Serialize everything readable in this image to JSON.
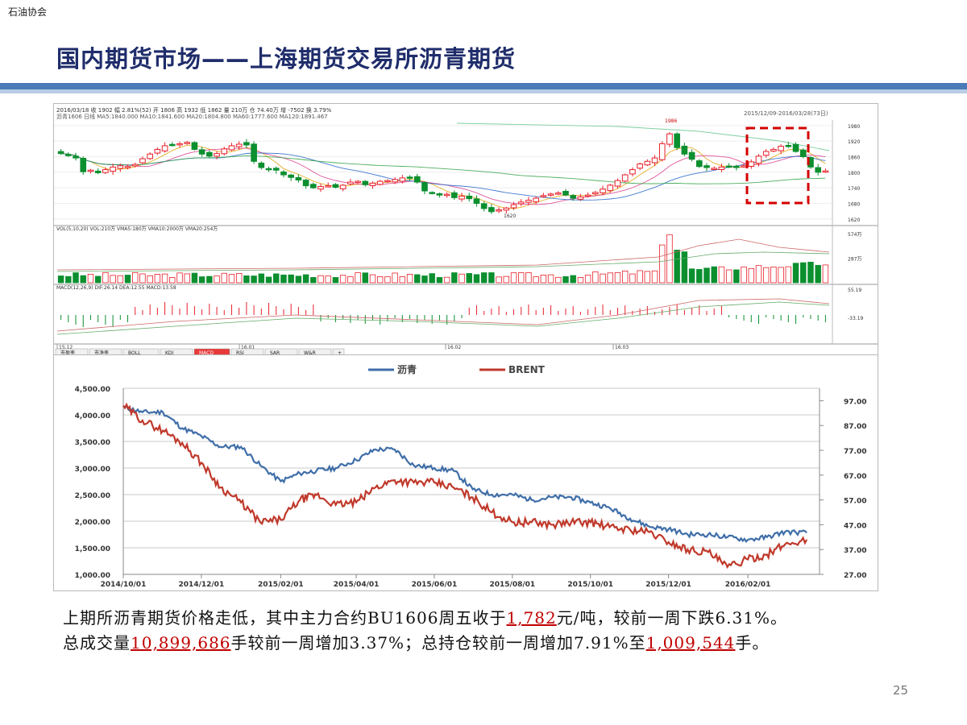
{
  "header": {
    "org": "石油协会",
    "title": "国内期货市场——上海期货交易所沥青期货"
  },
  "kline": {
    "info_row1": "2016/03/18  收 1902  幅 2.81%(52)  开 1806  高 1932  低 1862  量 210万  仓 74.40万  增 -7502  换 3.79%",
    "info_row2": "沥青1606  日线  MA5:1840.000  MA10:1841.600  MA20:1804.800  MA60:1777.600  MA120:1891.467",
    "range_label": "2015/12/09-2016/03/28(73日)",
    "price_ticks": [
      "1980",
      "1920",
      "1860",
      "1800",
      "1740",
      "1680",
      "1620"
    ],
    "high_label": "1986",
    "low_label": "1620",
    "vol_info": "VOL(5,10,20)  VOL:210万  VMA5:180万  VMA10:2000万  VMA20:254万",
    "vol_ticks": [
      "574万",
      "287万"
    ],
    "macd_info": "MACD(12,26,9)  DIF:26.14  DEA:12.55  MACD:13.58",
    "macd_ticks": [
      "55.19",
      "-33.19"
    ],
    "date_labels": [
      "15.12",
      "16.01",
      "16.02",
      "16.03"
    ],
    "tabs": [
      "市盈率",
      "市净率",
      "BOLL",
      "KDJ",
      "MACD",
      "RSI",
      "SAR",
      "W&R",
      "+"
    ],
    "colors": {
      "up": "#e8202a",
      "down": "#0b8f2f",
      "box": "#d40000"
    }
  },
  "chart_data": {
    "type": "line",
    "series": [
      {
        "name": "沥青",
        "axis": "left",
        "color": "#3f6ea8",
        "x": [
          "2014/10/01",
          "2014/10/16",
          "2014/11/01",
          "2014/11/16",
          "2014/12/01",
          "2014/12/16",
          "2015/01/01",
          "2015/01/16",
          "2015/02/01",
          "2015/02/16",
          "2015/03/01",
          "2015/03/16",
          "2015/04/01",
          "2015/04/16",
          "2015/05/01",
          "2015/05/16",
          "2015/06/01",
          "2015/06/16",
          "2015/07/01",
          "2015/07/16",
          "2015/08/01",
          "2015/08/16",
          "2015/09/01",
          "2015/09/16",
          "2015/10/01",
          "2015/10/16",
          "2015/11/01",
          "2015/11/16",
          "2015/12/01",
          "2015/12/16",
          "2016/01/01",
          "2016/01/16",
          "2016/02/01",
          "2016/02/16",
          "2016/03/01",
          "2016/03/18"
        ],
        "values": [
          4150,
          4050,
          4050,
          3750,
          3600,
          3400,
          3400,
          3050,
          2750,
          2900,
          2950,
          3000,
          3150,
          3350,
          3350,
          3050,
          3000,
          2950,
          2600,
          2500,
          2500,
          2400,
          2450,
          2450,
          2350,
          2250,
          2050,
          1900,
          1850,
          1750,
          1750,
          1700,
          1650,
          1700,
          1800,
          1782
        ]
      },
      {
        "name": "BRENT",
        "axis": "right",
        "color": "#c0392b",
        "x": [
          "2014/10/01",
          "2014/10/16",
          "2014/11/01",
          "2014/11/16",
          "2014/12/01",
          "2014/12/16",
          "2015/01/01",
          "2015/01/16",
          "2015/02/01",
          "2015/02/16",
          "2015/03/01",
          "2015/03/16",
          "2015/04/01",
          "2015/04/16",
          "2015/05/01",
          "2015/05/16",
          "2015/06/01",
          "2015/06/16",
          "2015/07/01",
          "2015/07/16",
          "2015/08/01",
          "2015/08/16",
          "2015/09/01",
          "2015/09/16",
          "2015/10/01",
          "2015/10/16",
          "2015/11/01",
          "2015/11/16",
          "2015/12/01",
          "2015/12/16",
          "2016/01/01",
          "2016/01/16",
          "2016/02/01",
          "2016/02/16",
          "2016/03/01",
          "2016/03/18"
        ],
        "values": [
          95,
          89,
          85,
          80,
          72,
          62,
          56,
          48,
          49,
          57,
          59,
          55,
          56,
          62,
          65,
          64,
          64,
          62,
          58,
          52,
          48,
          48,
          47,
          48,
          48,
          46,
          45,
          44,
          40,
          37,
          36,
          30,
          33,
          35,
          39,
          41
        ]
      }
    ],
    "ylim_left": [
      1000,
      4500
    ],
    "ylim_right": [
      27,
      102
    ],
    "yticks_left": [
      "4,500.00",
      "4,000.00",
      "3,500.00",
      "3,000.00",
      "2,500.00",
      "2,000.00",
      "1,500.00",
      "1,000.00"
    ],
    "yticks_right": [
      "97.00",
      "87.00",
      "77.00",
      "67.00",
      "57.00",
      "47.00",
      "37.00",
      "27.00"
    ],
    "xticks": [
      "2014/10/01",
      "2014/12/01",
      "2015/02/01",
      "2015/04/01",
      "2015/06/01",
      "2015/08/01",
      "2015/10/01",
      "2015/12/01",
      "2016/02/01"
    ],
    "legend": [
      "沥青",
      "BRENT"
    ],
    "legend_position": "top-center",
    "grid": true
  },
  "summary": {
    "l1_a": "上期所沥青期货价格走低，其中主力合约BU1606周五收于",
    "l1_price": "1,782",
    "l1_b": "元/吨，较前一周下跌6.31%。",
    "l2_a": "总成交量",
    "l2_volume": "10,899,686",
    "l2_b": "手较前一周增加3.37%；总持仓较前一周增加7.91%至",
    "l2_oi": "1,009,544",
    "l2_c": "手。"
  },
  "page_number": "25"
}
